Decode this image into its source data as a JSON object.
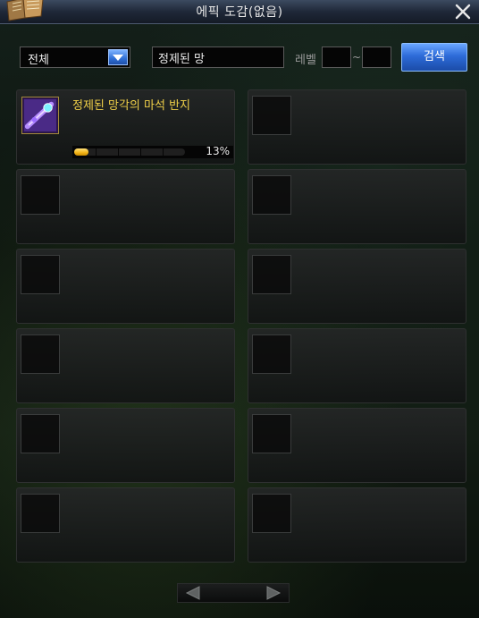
{
  "window": {
    "title": "에픽 도감(없음)",
    "close_icon": "close-icon",
    "book_icon": "book-icon"
  },
  "filters": {
    "category_selected": "전체",
    "search_value": "정제된 망",
    "level_label": "레벨",
    "level_separator": "~",
    "level_min": "",
    "level_max": "",
    "search_button_label": "검색"
  },
  "items": [
    {
      "name": "정제된 망각의 마석 반지",
      "progress_text": "13%",
      "progress": 0.13,
      "icon": "ring-icon"
    }
  ],
  "empty_slots": 11,
  "colors": {
    "item_name": "#f0d048",
    "accent_button": "#2d6bd8",
    "progress_fill": "#f2b317"
  }
}
